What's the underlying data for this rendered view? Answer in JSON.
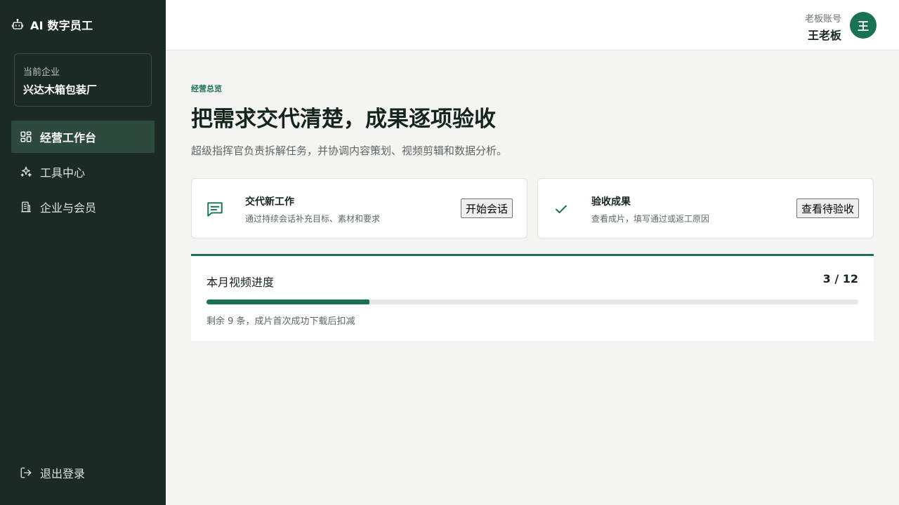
{
  "brand": {
    "title": "AI 数字员工",
    "icon": "robot-icon"
  },
  "company": {
    "label": "当前企业",
    "name": "兴达木箱包装厂"
  },
  "nav": {
    "items": [
      {
        "label": "经营工作台",
        "icon": "dashboard-icon",
        "active": true
      },
      {
        "label": "工具中心",
        "icon": "sparkle-icon",
        "active": false
      },
      {
        "label": "企业与会员",
        "icon": "building-icon",
        "active": false
      }
    ],
    "logout": {
      "label": "退出登录",
      "icon": "logout-icon"
    }
  },
  "account": {
    "label": "老板账号",
    "name": "王老板",
    "avatar": "王"
  },
  "main": {
    "eyebrow": "经营总览",
    "headline": "把需求交代清楚，成果逐项验收",
    "subtitle": "超级指挥官负责拆解任务，并协调内容策划、视频剪辑和数据分析。"
  },
  "cards": [
    {
      "title": "交代新工作",
      "desc": "通过持续会话补充目标、素材和要求",
      "button": "开始会话",
      "icon": "chat-icon"
    },
    {
      "title": "验收成果",
      "desc": "查看成片，填写通过或返工原因",
      "button": "查看待验收",
      "icon": "check-icon"
    }
  ],
  "progress": {
    "title": "本月视频进度",
    "count": "3 / 12",
    "done": 3,
    "total": 12,
    "note": "剩余 9 条，成片首次成功下载后扣减"
  },
  "colors": {
    "sidebar": "#1b2a24",
    "accent": "#1a7350",
    "background": "#f4f4f2"
  }
}
